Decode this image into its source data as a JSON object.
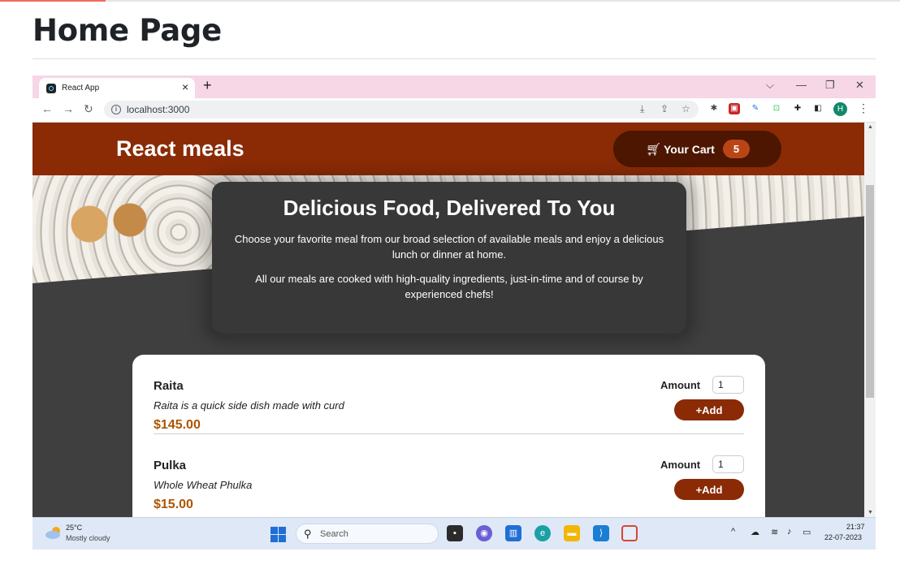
{
  "document": {
    "title": "Home Page"
  },
  "browser": {
    "tab_title": "React App",
    "tab_close": "×",
    "new_tab": "+",
    "url": "localhost:3000",
    "profile_initial": "H",
    "controls": {
      "minimize": "—",
      "restore": "❐",
      "close": "✕",
      "dropdown": "⌵"
    }
  },
  "app": {
    "brand": "React meals",
    "cart": {
      "label": "Your Cart",
      "count": "5"
    },
    "summary": {
      "title": "Delicious Food, Delivered To You",
      "paragraph1": "Choose your favorite meal from our broad selection of available meals and enjoy a delicious lunch or dinner at home.",
      "paragraph2": "All our meals are cooked with high-quality ingredients, just-in-time and of course by experienced chefs!"
    },
    "meals": [
      {
        "name": "Raita",
        "description": "Raita is a quick side dish made with curd",
        "price": "$145.00",
        "amount_label": "Amount",
        "amount_value": "1",
        "add_label": "+Add"
      },
      {
        "name": "Pulka",
        "description": "Whole Wheat Phulka",
        "price": "$15.00",
        "amount_label": "Amount",
        "amount_value": "1",
        "add_label": "+Add"
      }
    ]
  },
  "taskbar": {
    "weather_temp": "25°C",
    "weather_desc": "Mostly cloudy",
    "search_placeholder": "Search",
    "time": "21:37",
    "date": "22-07-2023"
  },
  "colors": {
    "header": "#8a2b06",
    "cart_button": "#4d1601",
    "cart_badge": "#b94517",
    "price": "#ad5502",
    "tab_strip": "#f7d6e6"
  }
}
